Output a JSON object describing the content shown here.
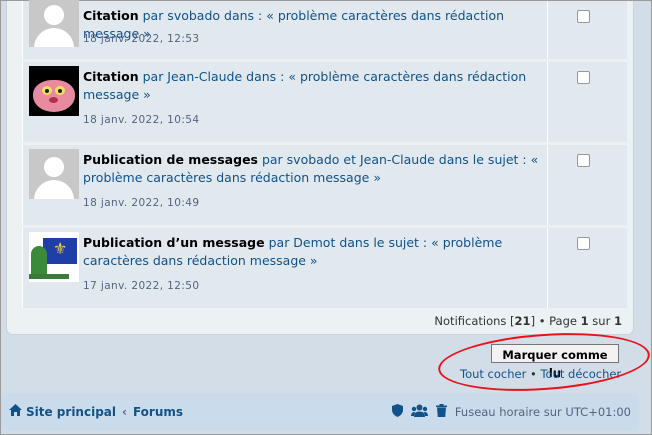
{
  "notifications": [
    {
      "avatar": "default-avatar",
      "type": "Citation",
      "rest": " par svobado dans : « problème caractères dans rédaction message »",
      "time": "18 janv. 2022, 12:53"
    },
    {
      "avatar": "pink-panther-avatar",
      "type": "Citation",
      "rest": " par Jean-Claude dans : « problème caractères dans rédaction message »",
      "time": "18 janv. 2022, 10:54"
    },
    {
      "avatar": "default-avatar",
      "type": "Publication de messages",
      "rest": " par svobado et Jean-Claude dans le sujet : « problème caractères dans rédaction message »",
      "time": "18 janv. 2022, 10:49"
    },
    {
      "avatar": "flag-avatar",
      "type": "Publication d’un message",
      "rest": " par Demot dans le sujet : « problème caractères dans rédaction message »",
      "time": "17 janv. 2022, 12:50"
    }
  ],
  "pagination": {
    "label": "Notifications [",
    "count": "21",
    "mid": "] • Page ",
    "page": "1",
    "of": " sur ",
    "total": "1"
  },
  "actions": {
    "mark_read": "Marquer comme lu",
    "check_all": "Tout cocher",
    "bullet": " • ",
    "uncheck_all": "Tout décocher"
  },
  "nav": {
    "home": "Site principal",
    "sep": "‹",
    "forums": "Forums",
    "timezone": "Fuseau horaire sur UTC+01:00"
  },
  "colors": {
    "link": "#105289",
    "highlight_circle": "#e8121c"
  }
}
